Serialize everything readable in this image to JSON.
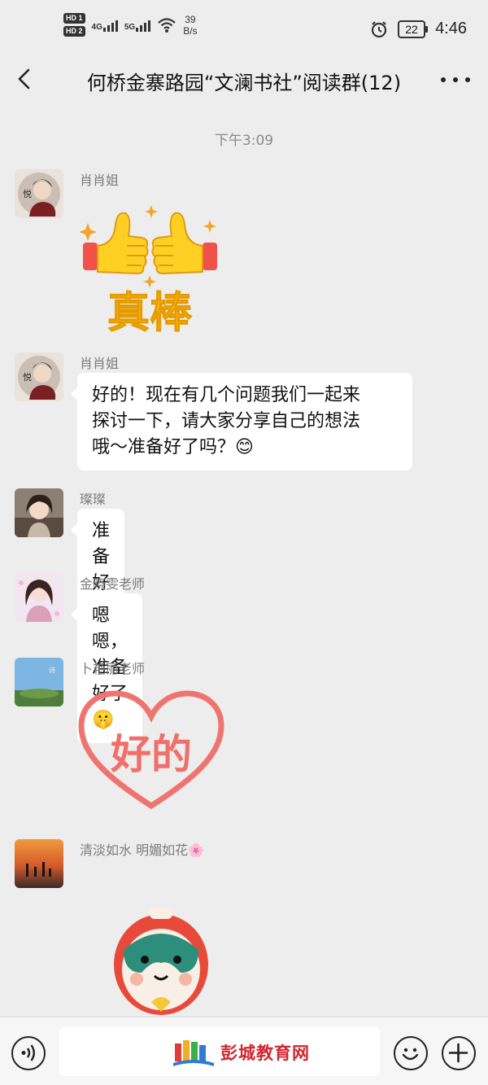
{
  "status_bar": {
    "sim1": "HD 1",
    "sim2": "HD 2",
    "network1": "4G",
    "network2": "5G",
    "speed_value": "39",
    "speed_unit": "B/s",
    "battery": "22",
    "time": "4:46"
  },
  "header": {
    "title": "何桥金寨路园“文澜书社”阅读群(12)"
  },
  "chat": {
    "timestamp": "下午3:09",
    "messages": [
      {
        "sender": "肖肖姐",
        "type": "sticker",
        "sticker_text": "真棒",
        "sticker_icon": "thumbs-up-sticker"
      },
      {
        "sender": "肖肖姐",
        "type": "text",
        "lines": [
          "好的！现在有几个问题我们一起来",
          "探讨一下，请大家分享自己的想法",
          "哦～准备好了吗？😊"
        ]
      },
      {
        "sender": "璨璨",
        "type": "text",
        "lines": [
          "准备好啦～"
        ]
      },
      {
        "sender": "金晓雯老师",
        "type": "text",
        "lines": [
          "嗯嗯，准备好了🤫"
        ]
      },
      {
        "sender": "卜艳丽老师",
        "type": "sticker",
        "sticker_text": "好的",
        "sticker_icon": "heart-sticker"
      },
      {
        "sender": "清淡如水    明媚如花🌸",
        "type": "sticker",
        "sticker_icon": "superhero-mascot-sticker"
      }
    ]
  },
  "input_bar": {
    "icons": [
      "voice-icon",
      "emoji-icon",
      "plus-icon"
    ]
  },
  "watermark": {
    "text": "彭城教育网"
  },
  "colors": {
    "background": "#ededed",
    "bubble": "#ffffff",
    "accent_red": "#d2262c"
  }
}
